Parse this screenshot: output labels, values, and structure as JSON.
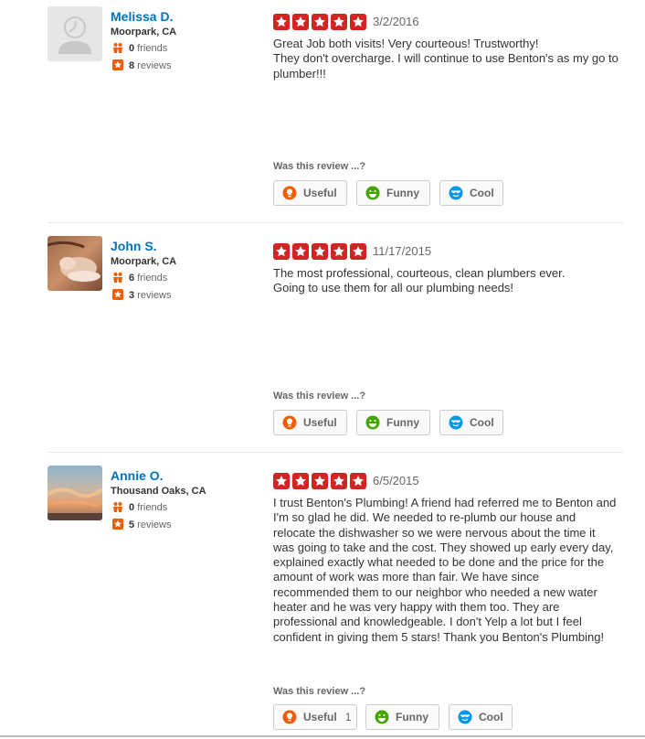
{
  "vote_prompt": "Was this review ...?",
  "vote_labels": {
    "useful": "Useful",
    "funny": "Funny",
    "cool": "Cool"
  },
  "colors": {
    "star_red": "#d32323",
    "link_blue": "#0073bb",
    "review_stars_orange": "#f15c00"
  },
  "reviews": [
    {
      "user": {
        "name": "Melissa D.",
        "location": "Moorpark, CA",
        "friends": "0",
        "friends_label": "friends",
        "reviews": "8",
        "reviews_label": "reviews",
        "avatar": "default-avatar"
      },
      "rating": 5,
      "date": "3/2/2016",
      "text": "Great Job both visits! Very courteous! Trustworthy!\nThey don't overcharge.  I will continue to use Benton's as my go to plumber!!!",
      "votes": {
        "useful": "",
        "funny": "",
        "cool": ""
      }
    },
    {
      "user": {
        "name": "John S.",
        "location": "Moorpark, CA",
        "friends": "6",
        "friends_label": "friends",
        "reviews": "3",
        "reviews_label": "reviews",
        "avatar": "photo"
      },
      "rating": 5,
      "date": "11/17/2015",
      "text": "The most professional, courteous, clean plumbers ever.\n Going to use them for all our plumbing needs!",
      "votes": {
        "useful": "",
        "funny": "",
        "cool": ""
      }
    },
    {
      "user": {
        "name": "Annie O.",
        "location": "Thousand Oaks, CA",
        "friends": "0",
        "friends_label": "friends",
        "reviews": "5",
        "reviews_label": "reviews",
        "avatar": "photo"
      },
      "rating": 5,
      "date": "6/5/2015",
      "text": "I trust Benton's Plumbing! A friend had referred me to Benton and I'm so glad he did. We needed to re-plumb our house and relocate the dishwasher so we were nervous about the time it was going to take and the cost. They showed up early every day, explained exactly what needed to be done and the price for the amount of work was more than fair. We have since recommended them to our neighbor who needed a new water heater and he was very happy with them too. They are professional and knowledgeable. I don't Yelp a lot but I feel confident in giving them 5 stars! Thank you Benton's Plumbing!",
      "votes": {
        "useful": "1",
        "funny": "",
        "cool": ""
      }
    }
  ]
}
